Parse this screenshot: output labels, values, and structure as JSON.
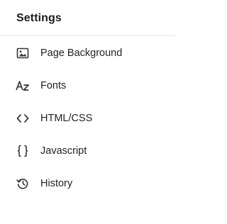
{
  "header": {
    "title": "Settings"
  },
  "menu": {
    "items": [
      {
        "label": "Page Background",
        "icon": "image-icon"
      },
      {
        "label": "Fonts",
        "icon": "font-icon"
      },
      {
        "label": "HTML/CSS",
        "icon": "code-icon"
      },
      {
        "label": "Javascript",
        "icon": "braces-icon"
      },
      {
        "label": "History",
        "icon": "history-icon"
      }
    ]
  },
  "colors": {
    "text": "#222226",
    "icon": "#34343a",
    "divider": "#e6e6e8",
    "background": "#ffffff"
  }
}
